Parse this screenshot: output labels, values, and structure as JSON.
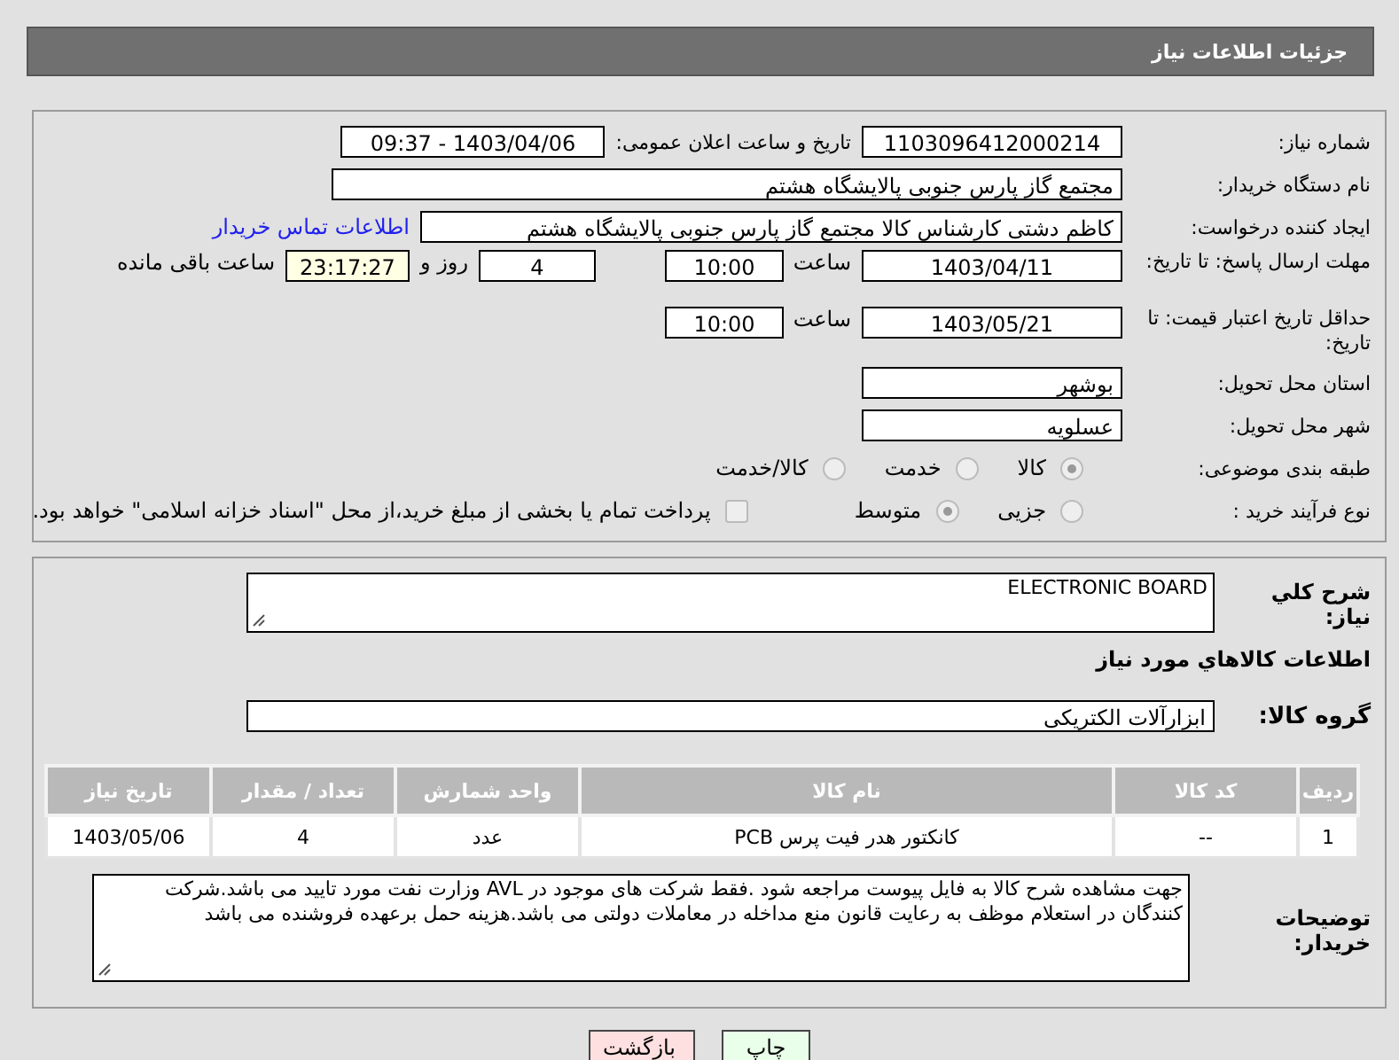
{
  "header": {
    "title": "جزئیات اطلاعات نیاز"
  },
  "need_number": {
    "label": "شماره نیاز:",
    "value": "1103096412000214"
  },
  "announce": {
    "label": "تاریخ و ساعت اعلان عمومی:",
    "value": "1403/04/06 - 09:37"
  },
  "buyer": {
    "label": "نام دستگاه خریدار:",
    "value": "مجتمع گاز پارس جنوبی  پالایشگاه هشتم"
  },
  "requester": {
    "label": "ایجاد کننده درخواست:",
    "value": "کاظم دشتی کارشناس کالا مجتمع گاز پارس جنوبی  پالایشگاه هشتم",
    "link": "اطلاعات تماس خریدار"
  },
  "reply_deadline": {
    "label": "مهلت ارسال پاسخ: تا تاریخ:",
    "date": "1403/04/11",
    "time_label": "ساعت",
    "time": "10:00",
    "days": "4",
    "days_label": "روز و",
    "remaining": "23:17:27",
    "remaining_label": "ساعت باقی مانده"
  },
  "price_validity": {
    "label": "حداقل تاریخ اعتبار قیمت: تا تاریخ:",
    "date": "1403/05/21",
    "time_label": "ساعت",
    "time": "10:00"
  },
  "province": {
    "label": "استان محل تحویل:",
    "value": "بوشهر"
  },
  "city": {
    "label": "شهر محل تحویل:",
    "value": "عسلویه"
  },
  "category": {
    "label": "طبقه بندی موضوعی:",
    "options": [
      {
        "label": "کالا",
        "selected": true
      },
      {
        "label": "خدمت",
        "selected": false
      },
      {
        "label": "کالا/خدمت",
        "selected": false
      }
    ]
  },
  "purchase_type": {
    "label": "نوع فرآیند خرید :",
    "options": [
      {
        "label": "جزیی",
        "selected": false
      },
      {
        "label": "متوسط",
        "selected": true
      }
    ],
    "treasury": {
      "checked": false,
      "label": "پرداخت تمام یا بخشی از مبلغ خرید،از محل \"اسناد خزانه اسلامی\" خواهد بود."
    }
  },
  "summary": {
    "label": "شرح کلي نياز:",
    "value": "ELECTRONIC BOARD"
  },
  "goods_heading": "اطلاعات کالاهاي مورد نياز",
  "goods_group": {
    "label": "گروه کالا:",
    "value": "ابزارآلات الکتریکی"
  },
  "table": {
    "columns": [
      "ردیف",
      "کد کالا",
      "نام کالا",
      "واحد شمارش",
      "تعداد / مقدار",
      "تاریخ نیاز"
    ],
    "rows": [
      [
        "1",
        "--",
        "کانکتور هدر فیت پرس PCB",
        "عدد",
        "4",
        "1403/05/06"
      ]
    ]
  },
  "buyer_notes": {
    "label": "توضیحات خریدار:",
    "value": "جهت مشاهده شرح کالا به فایل پیوست مراجعه شود .فقط شرکت های موجود در AVL وزارت نفت مورد تایید می باشد.شرکت کنندگان در استعلام موظف به رعایت قانون منع مداخله در معاملات دولتی می باشد.هزینه حمل برعهده فروشنده می باشد"
  },
  "buttons": [
    {
      "label": "چاپ",
      "kind": "print"
    },
    {
      "label": "بازگشت",
      "kind": "back"
    }
  ]
}
